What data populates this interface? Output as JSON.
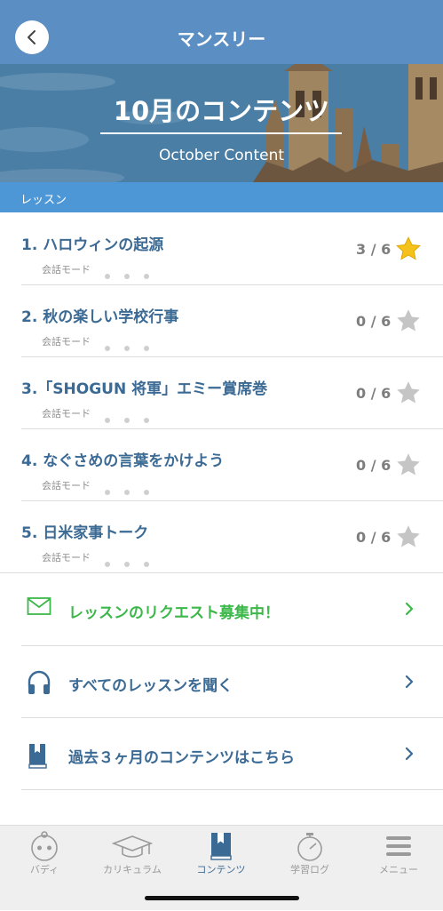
{
  "header": {
    "title": "マンスリー"
  },
  "hero": {
    "title": "10月のコンテンツ",
    "subtitle": "October Content"
  },
  "section": {
    "label": "レッスン"
  },
  "lessons": [
    {
      "title": "1. ハロウィンの起源",
      "mode": "会話モード",
      "progress": "3 / 6",
      "completed": true
    },
    {
      "title": "2. 秋の楽しい学校行事",
      "mode": "会話モード",
      "progress": "0 / 6",
      "completed": false
    },
    {
      "title": "3.「SHOGUN 将軍」エミー賞席巻",
      "mode": "会話モード",
      "progress": "0 / 6",
      "completed": false
    },
    {
      "title": "4. なぐさめの言葉をかけよう",
      "mode": "会話モード",
      "progress": "0 / 6",
      "completed": false
    },
    {
      "title": "5. 日米家事トーク",
      "mode": "会話モード",
      "progress": "0 / 6",
      "completed": false
    }
  ],
  "actions": [
    {
      "label": "レッスンのリクエスト募集中！",
      "icon": "mail-icon",
      "color": "#3cb84a"
    },
    {
      "label": "すべてのレッスンを聞く",
      "icon": "headphones-icon",
      "color": "#3b6a94"
    },
    {
      "label": "過去３ヶ月のコンテンツはこちら",
      "icon": "book-icon",
      "color": "#3b6a94"
    }
  ],
  "tabs": [
    {
      "label": "バディ",
      "icon": "buddy-icon"
    },
    {
      "label": "カリキュラム",
      "icon": "graduation-cap-icon"
    },
    {
      "label": "コンテンツ",
      "icon": "book-icon",
      "active": true
    },
    {
      "label": "学習ログ",
      "icon": "stopwatch-icon"
    },
    {
      "label": "メニュー",
      "icon": "menu-icon"
    }
  ],
  "colors": {
    "header": "#5b8ec2",
    "section": "#4e97d6",
    "lesson_title": "#3b6a94",
    "star_active": "#f4c21b",
    "star_inactive": "#c5c5c5",
    "tab_active": "#3b6a94",
    "tab_inactive": "#9a9a9a"
  }
}
